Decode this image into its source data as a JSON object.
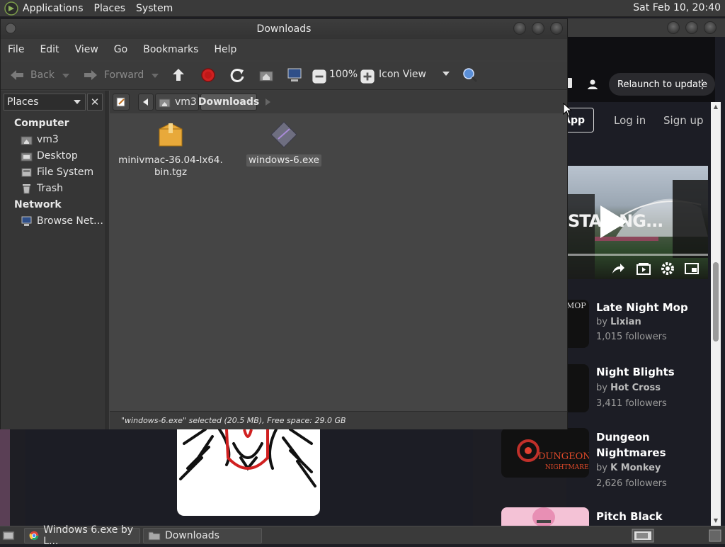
{
  "topbar": {
    "menus": [
      "Applications",
      "Places",
      "System"
    ],
    "clock": "Sat Feb 10, 20:40"
  },
  "browser": {
    "relaunch_label": "Relaunch to update",
    "app_button": "App",
    "login": "Log in",
    "signup": "Sign up",
    "video_overlay_text": "STA...NG...",
    "games": [
      {
        "title": "Late Night Mop",
        "by_prefix": "by",
        "author": "Lixian",
        "followers": "1,015 followers",
        "thumb_text": "MOP"
      },
      {
        "title": "Night Blights",
        "by_prefix": "by",
        "author": "Hot Cross",
        "followers": "3,411 followers"
      },
      {
        "title": "Dungeon Nightmares",
        "by_prefix": "by",
        "author": "K Monkey",
        "followers": "2,626 followers",
        "thumb_text": "DUNGEON NIGHTMARES"
      },
      {
        "title": "Pitch Black",
        "by_prefix": "",
        "author": "",
        "followers": ""
      }
    ]
  },
  "filemanager": {
    "title": "Downloads",
    "menu": [
      "File",
      "Edit",
      "View",
      "Go",
      "Bookmarks",
      "Help"
    ],
    "toolbar": {
      "back": "Back",
      "forward": "Forward",
      "zoom": "100%",
      "view_mode": "Icon View"
    },
    "sidebar": {
      "selector": "Places",
      "close": "✕",
      "sections": [
        {
          "header": "Computer",
          "items": [
            "vm3",
            "Desktop",
            "File System",
            "Trash"
          ]
        },
        {
          "header": "Network",
          "items": [
            "Browse Net…"
          ]
        }
      ]
    },
    "path": {
      "segments": [
        "vm3",
        "Downloads"
      ]
    },
    "files": [
      {
        "name_line1": "minivmac-36.04-lx64.",
        "name_line2": "bin.tgz",
        "icon": "archive-icon",
        "selected": false
      },
      {
        "name_line1": "windows-6.exe",
        "name_line2": "",
        "icon": "executable-icon",
        "selected": true
      }
    ],
    "status": "\"windows-6.exe\" selected (20.5 MB), Free space: 29.0 GB"
  },
  "taskbar": {
    "tasks": [
      "Windows 6.exe by L...",
      "Downloads"
    ]
  },
  "colors": {
    "accent_red": "#d02020",
    "window_bg": "#3c3c3c",
    "content_bg": "#454545"
  }
}
